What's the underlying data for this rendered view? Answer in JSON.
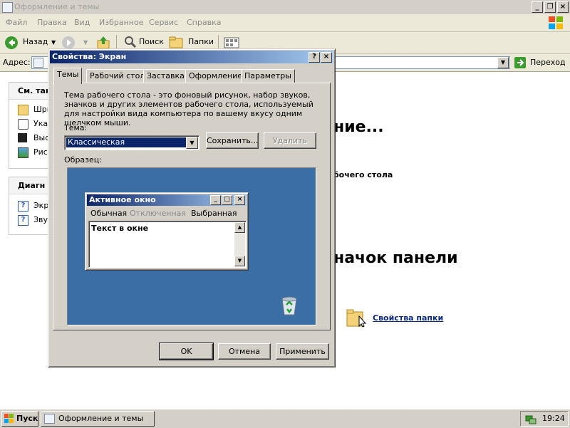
{
  "explorer": {
    "title": "Оформление и темы",
    "menu": [
      "Файл",
      "Правка",
      "Вид",
      "Избранное",
      "Сервис",
      "Справка"
    ],
    "toolbar": {
      "back": "Назад",
      "search": "Поиск",
      "folders": "Папки"
    },
    "address": {
      "label": "Адрес:",
      "go": "Переход"
    },
    "left_panes": [
      {
        "heading": "См. так",
        "items": [
          "Шри",
          "Ука",
          "Выс",
          "Рис"
        ]
      },
      {
        "heading": "Диагн",
        "items": [
          "Экр",
          "Зву"
        ]
      }
    ],
    "content": {
      "heading1": "ние...",
      "line1": "бочего стола",
      "heading2": "начок панели",
      "link": "Свойства папки"
    }
  },
  "dialog": {
    "title": "Свойства: Экран",
    "help_btn": "?",
    "close_btn": "×",
    "tabs": [
      "Темы",
      "Рабочий стол",
      "Заставка",
      "Оформление",
      "Параметры"
    ],
    "active_tab": "Темы",
    "description": "Тема рабочего стола - это фоновый рисунок, набор звуков, значков и других элементов рабочего стола, используемый для настройки вида компьютера по вашему вкусу одним щелчком мыши.",
    "theme_label": "Тема:",
    "theme_value": "Классическая",
    "save_btn": "Сохранить...",
    "delete_btn": "Удалить",
    "sample_label": "Образец:",
    "sample": {
      "window_title": "Активное окно",
      "menu": [
        "Обычная",
        "Отключенная",
        "Выбранная"
      ],
      "text": "Текст в окне"
    },
    "ok": "OK",
    "cancel": "Отмена",
    "apply": "Применить"
  },
  "taskbar": {
    "start": "Пуск",
    "task": "Оформление и темы",
    "clock": "19:24"
  },
  "colors": {
    "desktop_preview": "#3a6ea5",
    "title_active": "#0a246a",
    "title_gradient_end": "#a6caf0",
    "face": "#d4d0c8"
  }
}
